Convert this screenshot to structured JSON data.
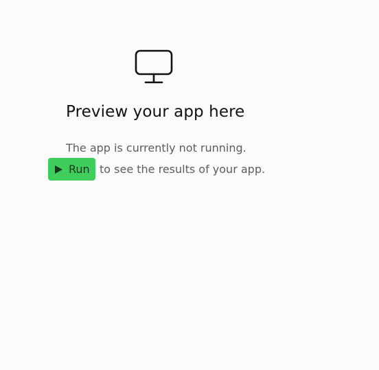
{
  "preview": {
    "icon": "monitor-icon",
    "title": "Preview your app here",
    "status_text": "The app is currently not running.",
    "run_button_label": "Run",
    "run_icon": "play-icon",
    "hint_text": "to see the results of your app."
  },
  "colors": {
    "background": "#fbfbfb",
    "run_button": "#3fce5b",
    "run_button_text": "#113b1a",
    "title_text": "#111111",
    "body_text": "#5d5d5d"
  }
}
